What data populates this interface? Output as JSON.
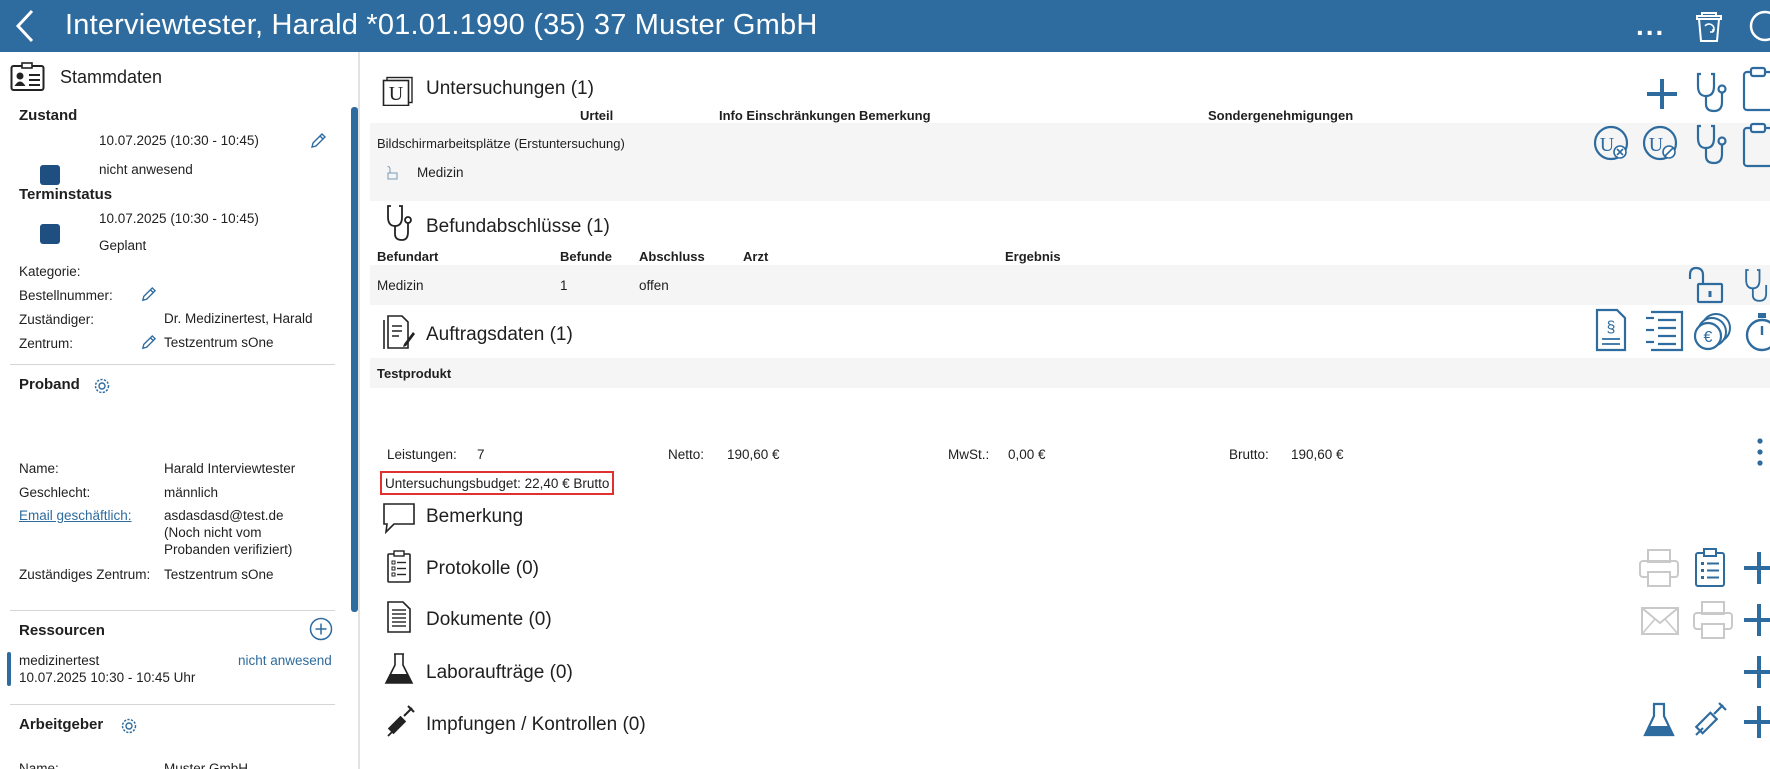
{
  "header": {
    "title": "Interviewtester, Harald *01.01.1990 (35) 37 Muster GmbH",
    "more": "..."
  },
  "left": {
    "stammdaten": "Stammdaten",
    "zustand": {
      "heading": "Zustand",
      "datetime": "10.07.2025 (10:30 - 10:45)",
      "status": "nicht anwesend"
    },
    "terminstatus": {
      "heading": "Terminstatus",
      "datetime": "10.07.2025 (10:30 - 10:45)",
      "status": "Geplant"
    },
    "fields": {
      "kategorie_label": "Kategorie:",
      "bestellnummer_label": "Bestellnummer:",
      "zustaendiger_label": "Zuständiger:",
      "zustaendiger_value": "Dr. Medizinertest, Harald",
      "zentrum_label": "Zentrum:",
      "zentrum_value": "Testzentrum sOne"
    },
    "proband": {
      "heading": "Proband",
      "name_label": "Name:",
      "name_value": "Harald Interviewtester",
      "geschlecht_label": "Geschlecht:",
      "geschlecht_value": "männlich",
      "email_label": "Email geschäftlich:",
      "email_value": "asdasdasd@test.de",
      "email_note_1": "(Noch nicht vom",
      "email_note_2": "Probanden verifiziert)",
      "zentrum_label": "Zuständiges Zentrum:",
      "zentrum_value": "Testzentrum sOne"
    },
    "ressourcen": {
      "heading": "Ressourcen",
      "name": "medizinertest",
      "status": "nicht anwesend",
      "time": "10.07.2025 10:30 - 10:45 Uhr"
    },
    "arbeitgeber": {
      "heading": "Arbeitgeber",
      "name_label": "Name:",
      "name_value": "Muster GmbH"
    }
  },
  "main": {
    "untersuchungen": {
      "title": "Untersuchungen (1)",
      "columns": [
        "Urteil",
        "Info Einschränkungen",
        "Bemerkung",
        "Sondergenehmigungen"
      ],
      "row_title": "Bildschirmarbeitsplätze (Erstuntersuchung)",
      "row_sub": "Medizin"
    },
    "befundabschluesse": {
      "title": "Befundabschlüsse (1)",
      "columns": [
        "Befundart",
        "Befunde",
        "Abschluss",
        "Arzt",
        "Ergebnis"
      ],
      "row": [
        "Medizin",
        "1",
        "offen",
        "",
        ""
      ]
    },
    "auftragsdaten": {
      "title": "Auftragsdaten (1)",
      "product": "Testprodukt",
      "leistungen_label": "Leistungen:",
      "leistungen_value": "7",
      "netto_label": "Netto:",
      "netto_value": "190,60 €",
      "mwst_label": "MwSt.:",
      "mwst_value": "0,00 €",
      "brutto_label": "Brutto:",
      "brutto_value": "190,60 €",
      "budget": "Untersuchungsbudget: 22,40 € Brutto"
    },
    "bemerkung": {
      "title": "Bemerkung"
    },
    "protokolle": {
      "title": "Protokolle (0)"
    },
    "dokumente": {
      "title": "Dokumente (0)"
    },
    "laborauftraege": {
      "title": "Laboraufträge (0)"
    },
    "impfungen": {
      "title": "Impfungen / Kontrollen (0)"
    }
  },
  "colors": {
    "header": "#2e6b9e",
    "accent": "#2e6b9e",
    "status_square": "#1e4f80",
    "highlight": "#e03030"
  }
}
